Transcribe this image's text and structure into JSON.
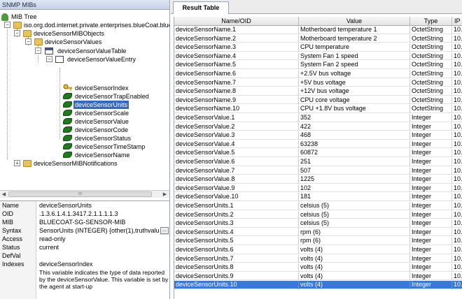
{
  "left_panel": {
    "title": "SNMP MIBs",
    "tree": {
      "root": "MIB Tree",
      "n1": "iso.org.dod.internet.private.enterprises.blueCoat.bluec",
      "n2": "deviceSensorMIBObjects",
      "n3": "deviceSensorValues",
      "n4": "deviceSensorValueTable",
      "n5": "deviceSensorValueEntry",
      "leaves": [
        "deviceSensorIndex",
        "deviceSensorTrapEnabled",
        "deviceSensorUnits",
        "deviceSensorScale",
        "deviceSensorValue",
        "deviceSensorCode",
        "deviceSensorStatus",
        "deviceSensorTimeStamp",
        "deviceSensorName"
      ],
      "selected_leaf": "deviceSensorUnits",
      "n6": "deviceSensorMIBNotifications"
    },
    "scroll_thumb": "III",
    "props": [
      {
        "k": "Name",
        "v": "deviceSensorUnits"
      },
      {
        "k": "OID",
        "v": ".1.3.6.1.4.1.3417.2.1.1.1.1.3"
      },
      {
        "k": "MIB",
        "v": "BLUECOAT-SG-SENSOR-MIB"
      },
      {
        "k": "Syntax",
        "v": "SensorUnits (INTEGER) {other(1),truthvalu..."
      },
      {
        "k": "Access",
        "v": "read-only"
      },
      {
        "k": "Status",
        "v": "current"
      },
      {
        "k": "DefVal",
        "v": ""
      },
      {
        "k": "Indexes",
        "v": "deviceSensorIndex"
      }
    ],
    "syntax_button": "...",
    "description": "This variable indicates the type of data reported by the deviceSensorValue. This variable is set by the agent at start-up"
  },
  "right_panel": {
    "tab": "Result Table",
    "columns": [
      "Name/OID",
      "Value",
      "Type",
      "IP"
    ],
    "rows": [
      [
        "deviceSensorName.1",
        "Motherboard temperature 1",
        "OctetString",
        "10.2"
      ],
      [
        "deviceSensorName.2",
        "Motherboard temperature 2",
        "OctetString",
        "10.2"
      ],
      [
        "deviceSensorName.3",
        "CPU temperature",
        "OctetString",
        "10.2"
      ],
      [
        "deviceSensorName.4",
        "System Fan 1 speed",
        "OctetString",
        "10.2"
      ],
      [
        "deviceSensorName.5",
        "System Fan 2 speed",
        "OctetString",
        "10.2"
      ],
      [
        "deviceSensorName.6",
        "+2.5V bus voltage",
        "OctetString",
        "10.2"
      ],
      [
        "deviceSensorName.7",
        "+5V bus voltage",
        "OctetString",
        "10.2"
      ],
      [
        "deviceSensorName.8",
        "+12V bus voltage",
        "OctetString",
        "10.2"
      ],
      [
        "deviceSensorName.9",
        "CPU core voltage",
        "OctetString",
        "10.2"
      ],
      [
        "deviceSensorName.10",
        "CPU +1.8V bus voltage",
        "OctetString",
        "10.2"
      ],
      [
        "deviceSensorValue.1",
        "352",
        "Integer",
        "10.2"
      ],
      [
        "deviceSensorValue.2",
        "422",
        "Integer",
        "10.2"
      ],
      [
        "deviceSensorValue.3",
        "468",
        "Integer",
        "10.2"
      ],
      [
        "deviceSensorValue.4",
        "63238",
        "Integer",
        "10.2"
      ],
      [
        "deviceSensorValue.5",
        "60872",
        "Integer",
        "10.2"
      ],
      [
        "deviceSensorValue.6",
        "251",
        "Integer",
        "10.2"
      ],
      [
        "deviceSensorValue.7",
        "507",
        "Integer",
        "10.2"
      ],
      [
        "deviceSensorValue.8",
        "1225",
        "Integer",
        "10.2"
      ],
      [
        "deviceSensorValue.9",
        "102",
        "Integer",
        "10.2"
      ],
      [
        "deviceSensorValue.10",
        "181",
        "Integer",
        "10.2"
      ],
      [
        "deviceSensorUnits.1",
        "celsius (5)",
        "Integer",
        "10.2"
      ],
      [
        "deviceSensorUnits.2",
        "celsius (5)",
        "Integer",
        "10.2"
      ],
      [
        "deviceSensorUnits.3",
        "celsius (5)",
        "Integer",
        "10.2"
      ],
      [
        "deviceSensorUnits.4",
        "rpm (6)",
        "Integer",
        "10.2"
      ],
      [
        "deviceSensorUnits.5",
        "rpm (6)",
        "Integer",
        "10.2"
      ],
      [
        "deviceSensorUnits.6",
        "volts (4)",
        "Integer",
        "10.2"
      ],
      [
        "deviceSensorUnits.7",
        "volts (4)",
        "Integer",
        "10.2"
      ],
      [
        "deviceSensorUnits.8",
        "volts (4)",
        "Integer",
        "10.2"
      ],
      [
        "deviceSensorUnits.9",
        "volts (4)",
        "Integer",
        "10.2"
      ],
      [
        "deviceSensorUnits.10",
        "volts (4)",
        "Integer",
        "10.2"
      ]
    ],
    "selected_row": 29
  }
}
